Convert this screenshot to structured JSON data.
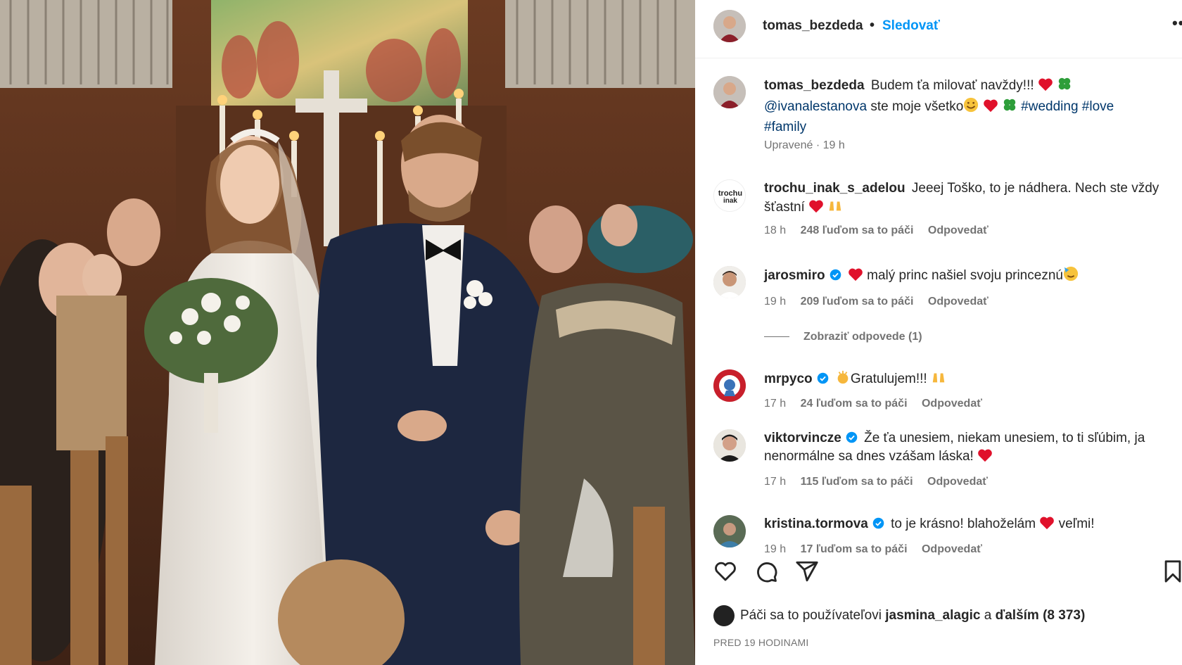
{
  "header": {
    "username": "tomas_bezdeda",
    "separator": "•",
    "follow_label": "Sledovať",
    "more_label": "••"
  },
  "caption": {
    "username": "tomas_bezdeda",
    "text_1": "Budem ťa milovať navždy!!!",
    "mention": "@ivanalestanova",
    "text_2": "ste moje všetko",
    "hashtag_1": "#wedding",
    "hashtag_2": "#love",
    "hashtag_3": "#family",
    "meta": "Upravené · 19 h"
  },
  "comments": [
    {
      "username": "trochu_inak_s_adelou",
      "verified": false,
      "text": "Jeeej Toško, to je nádhera. Nech ste vždy šťastní",
      "time": "18 h",
      "likes": "248 ľuďom sa to páči",
      "reply": "Odpovedať"
    },
    {
      "username": "jarosmiro",
      "verified": true,
      "text": "malý princ našiel svoju princeznú",
      "time": "19 h",
      "likes": "209 ľuďom sa to páči",
      "reply": "Odpovedať"
    },
    {
      "username": "mrpyco",
      "verified": true,
      "text": "Gratulujem!!!",
      "time": "17 h",
      "likes": "24 ľuďom sa to páči",
      "reply": "Odpovedať"
    },
    {
      "username": "viktorvincze",
      "verified": true,
      "text": "Že ťa unesiem, niekam unesiem, to ti sľúbim, ja nenormálne sa dnes vzášam láska!",
      "time": "17 h",
      "likes": "115 ľuďom sa to páči",
      "reply": "Odpovedať"
    },
    {
      "username": "kristina.tormova",
      "verified": true,
      "text_1": "to je krásno! blahoželám",
      "text_2": "veľmi!",
      "time": "19 h",
      "likes": "17 ľuďom sa to páči",
      "reply": "Odpovedať"
    }
  ],
  "view_replies": "Zobraziť odpovede (1)",
  "actions": [
    "heart-icon",
    "comment-icon",
    "share-icon",
    "bookmark-icon"
  ],
  "likes_line": {
    "prefix": "Páči sa to používateľovi",
    "user": "jasmina_alagic",
    "conj": "a",
    "others": "ďalším (8 373)"
  },
  "posted_ago": "PRED 19 HODINAMI",
  "colors": {
    "link": "#0095f6",
    "mention": "#00376b",
    "muted": "#737373",
    "heart": "#e0112b",
    "verified": "#0095f6"
  }
}
